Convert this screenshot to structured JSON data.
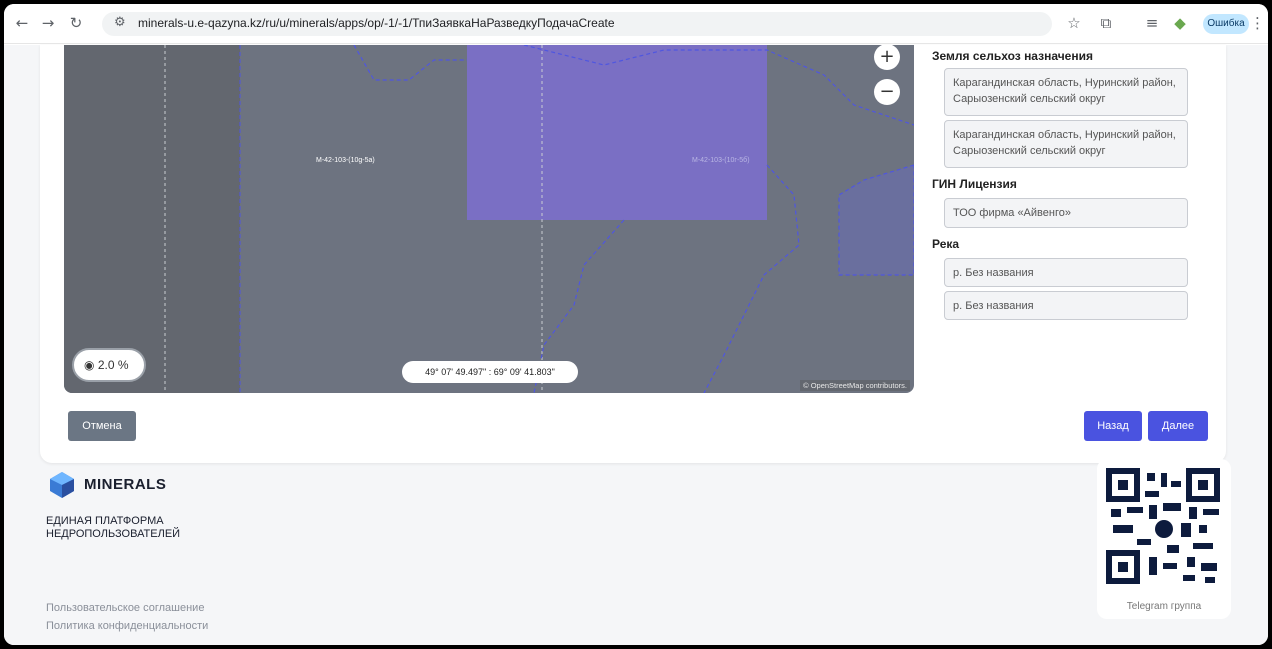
{
  "browser": {
    "url": "minerals-u.e-qazyna.kz/ru/u/minerals/apps/op/-1/-1/ТпиЗаявкаНаРазведкуПодачаCreate",
    "error_badge": "Ошибка"
  },
  "map": {
    "labels": [
      "M-42-103-(10g-5a)",
      "M-42-103-(10г-5б)"
    ],
    "scale": "2.0 %",
    "coordinates": "49° 07' 49.497\" : 69° 09' 41.803\"",
    "attribution": "© OpenStreetMap contributors.",
    "colors": {
      "map_bg": "#6d7380",
      "area": "#7a6fc4",
      "boundary": "#4f56e0"
    }
  },
  "side": {
    "agri_title": "Земля сельхоз назначения",
    "agri_values": [
      "Карагандинская область, Нуринский район, Сарыозенский сельский округ",
      "Карагандинская область, Нуринский район, Сарыозенский сельский округ"
    ],
    "gin_title": "ГИН Лицензия",
    "gin_value": "ТОО фирма «Айвенго»",
    "river_title": "Река",
    "river_values": [
      "р. Без названия",
      "р. Без названия"
    ]
  },
  "actions": {
    "cancel": "Отмена",
    "back": "Назад",
    "next": "Далее"
  },
  "footer": {
    "brand": "MINERALS",
    "platform_line1": "ЕДИНАЯ ПЛАТФОРМА",
    "platform_line2": "НЕДРОПОЛЬЗОВАТЕЛЕЙ",
    "links": [
      "Пользовательское соглашение",
      "Политика конфиденциальности"
    ],
    "qr_caption": "Telegram группа"
  },
  "icons": {
    "back": "back-arrow-icon",
    "forward": "forward-arrow-icon",
    "reload": "reload-icon",
    "tune": "site-settings-icon",
    "star": "bookmark-star-icon",
    "extensions": "extension-icon",
    "media": "media-control-icon",
    "profile": "profile-icon",
    "menu": "kebab-menu-icon",
    "zoom_in": "zoom-in-icon",
    "zoom_out": "zoom-out-icon",
    "scale": "scale-target-icon",
    "logo": "minerals-logo-icon",
    "qr": "qr-code-icon"
  }
}
